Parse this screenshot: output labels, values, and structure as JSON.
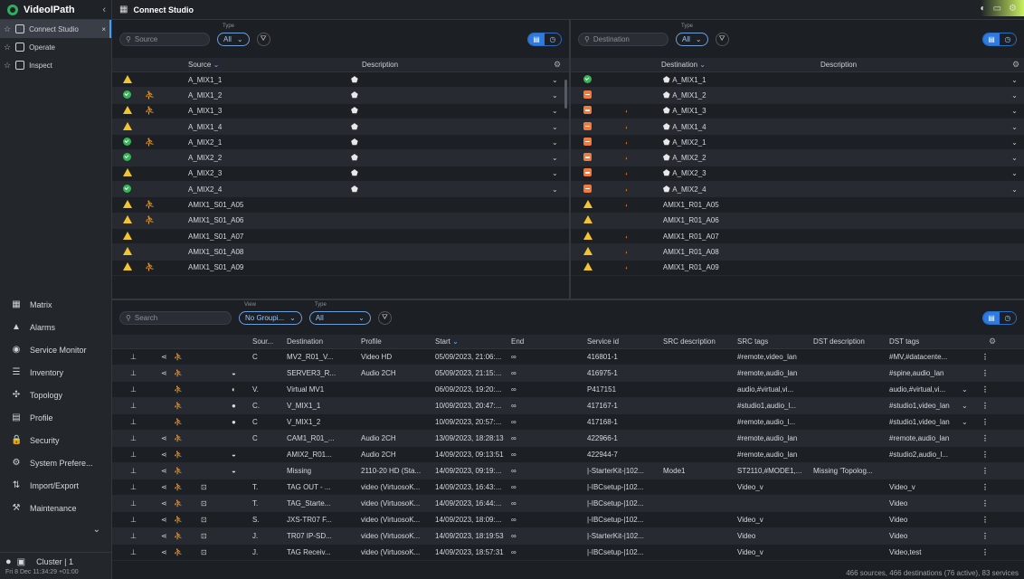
{
  "app": {
    "name": "VideoIPath",
    "collapse": "‹"
  },
  "sidebar": {
    "tabs": [
      {
        "label": "Connect Studio",
        "active": true,
        "close": "×"
      },
      {
        "label": "Operate",
        "active": false
      },
      {
        "label": "Inspect",
        "active": false
      }
    ],
    "menu": [
      {
        "label": "Matrix",
        "icon": "grid-icon",
        "glyph": "▦"
      },
      {
        "label": "Alarms",
        "icon": "alarm-icon",
        "glyph": "▲"
      },
      {
        "label": "Service Monitor",
        "icon": "eye-icon",
        "glyph": "◉"
      },
      {
        "label": "Inventory",
        "icon": "list-icon",
        "glyph": "☰"
      },
      {
        "label": "Topology",
        "icon": "topology-icon",
        "glyph": "✣"
      },
      {
        "label": "Profile",
        "icon": "profile-icon",
        "glyph": "▤"
      },
      {
        "label": "Security",
        "icon": "lock-icon",
        "glyph": "🔒"
      },
      {
        "label": "System Prefere...",
        "icon": "gear-icon",
        "glyph": "⚙"
      },
      {
        "label": "Import/Export",
        "icon": "import-export-icon",
        "glyph": "⇅"
      },
      {
        "label": "Maintenance",
        "icon": "maintenance-icon",
        "glyph": "⚒"
      }
    ],
    "more": "⌄",
    "footer": {
      "cluster": "Cluster | 1",
      "clock": "Fri 8 Dec  11:34:29 +01:00"
    }
  },
  "topbar": {
    "title": "Connect Studio"
  },
  "source_pane": {
    "search_placeholder": "Source",
    "type_label": "Type",
    "type_value": "All",
    "col_source": "Source",
    "col_description": "Description",
    "rows": [
      {
        "status": "warn",
        "person": false,
        "name": "A_MIX1_1",
        "hex": true,
        "chev": true
      },
      {
        "status": "ok",
        "person": true,
        "name": "A_MIX1_2",
        "hex": true,
        "chev": true
      },
      {
        "status": "warn",
        "person": true,
        "name": "A_MIX1_3",
        "hex": true,
        "chev": true
      },
      {
        "status": "warn",
        "person": false,
        "name": "A_MIX1_4",
        "hex": true,
        "chev": true
      },
      {
        "status": "ok",
        "person": true,
        "name": "A_MIX2_1",
        "hex": true,
        "chev": true
      },
      {
        "status": "ok",
        "person": false,
        "name": "A_MIX2_2",
        "hex": true,
        "chev": true
      },
      {
        "status": "warn",
        "person": false,
        "name": "A_MIX2_3",
        "hex": true,
        "chev": true
      },
      {
        "status": "ok",
        "person": false,
        "name": "A_MIX2_4",
        "hex": true,
        "chev": true
      },
      {
        "status": "warn",
        "person": true,
        "name": "AMIX1_S01_A05",
        "hex": false,
        "chev": false
      },
      {
        "status": "warn",
        "person": true,
        "name": "AMIX1_S01_A06",
        "hex": false,
        "chev": false
      },
      {
        "status": "warn",
        "person": false,
        "name": "AMIX1_S01_A07",
        "hex": false,
        "chev": false
      },
      {
        "status": "warn",
        "person": false,
        "name": "AMIX1_S01_A08",
        "hex": false,
        "chev": false
      },
      {
        "status": "warn",
        "person": true,
        "name": "AMIX1_S01_A09",
        "hex": false,
        "chev": false
      }
    ]
  },
  "dest_pane": {
    "search_placeholder": "Destination",
    "type_label": "Type",
    "type_value": "All",
    "col_destination": "Destination",
    "col_description": "Description",
    "rows": [
      {
        "status": "ok",
        "person": false,
        "name": "A_MIX1_1",
        "hex": true,
        "chev": true
      },
      {
        "status": "err",
        "person": false,
        "name": "A_MIX1_2",
        "hex": true,
        "chev": true
      },
      {
        "status": "err",
        "person": true,
        "name": "A_MIX1_3",
        "hex": true,
        "chev": true
      },
      {
        "status": "err",
        "person": true,
        "name": "A_MIX1_4",
        "hex": true,
        "chev": true
      },
      {
        "status": "err",
        "person": true,
        "name": "A_MIX2_1",
        "hex": true,
        "chev": true
      },
      {
        "status": "err",
        "person": true,
        "name": "A_MIX2_2",
        "hex": true,
        "chev": true
      },
      {
        "status": "err",
        "person": true,
        "name": "A_MIX2_3",
        "hex": true,
        "chev": true
      },
      {
        "status": "err",
        "person": true,
        "name": "A_MIX2_4",
        "hex": true,
        "chev": true
      },
      {
        "status": "warn",
        "person": true,
        "name": "AMIX1_R01_A05",
        "hex": false,
        "chev": false
      },
      {
        "status": "warn",
        "person": false,
        "name": "AMIX1_R01_A06",
        "hex": false,
        "chev": false
      },
      {
        "status": "warn",
        "person": true,
        "name": "AMIX1_R01_A07",
        "hex": false,
        "chev": false
      },
      {
        "status": "warn",
        "person": true,
        "name": "AMIX1_R01_A08",
        "hex": false,
        "chev": false
      },
      {
        "status": "warn",
        "person": true,
        "name": "AMIX1_R01_A09",
        "hex": false,
        "chev": false
      }
    ]
  },
  "services": {
    "search_placeholder": "Search",
    "view_label": "View",
    "view_value": "No Groupi...",
    "type_label": "Type",
    "type_value": "All",
    "columns": {
      "source": "Sour...",
      "destination": "Destination",
      "profile": "Profile",
      "start": "Start",
      "end": "End",
      "service_id": "Service id",
      "src_desc": "SRC description",
      "src_tags": "SRC tags",
      "dst_desc": "DST description",
      "dst_tags": "DST tags"
    },
    "rows": [
      {
        "status": "err",
        "share": true,
        "person": true,
        "lock": false,
        "diamond": "",
        "type": "C",
        "destination": "MV2_R01_V...",
        "profile": "Video HD",
        "start": "05/09/2023, 21:06:...",
        "end": "∞",
        "service_id": "416801-1",
        "src_desc": "",
        "src_tags": "#remote,video_lan",
        "dst_desc": "",
        "dst_tags": "#MV,#datacente...",
        "chev": false
      },
      {
        "status": "err",
        "share": true,
        "person": true,
        "lock": false,
        "diamond": "◒",
        "type": "",
        "destination": "SERVER3_R...",
        "profile": "Audio 2CH",
        "start": "05/09/2023, 21:15:...",
        "end": "∞",
        "service_id": "416975-1",
        "src_desc": "",
        "src_tags": "#remote,audio_lan",
        "dst_desc": "",
        "dst_tags": "#spine,audio_lan",
        "chev": false
      },
      {
        "status": "ok",
        "share": false,
        "person": true,
        "lock": false,
        "diamond": "◐",
        "type": "V.",
        "destination": "Virtual MV1",
        "profile": "",
        "start": "06/09/2023, 19:20:...",
        "end": "∞",
        "service_id": "P417151",
        "src_desc": "",
        "src_tags": "audio,#virtual,vi...",
        "dst_desc": "",
        "dst_tags": "audio,#virtual,vi...",
        "chev": true
      },
      {
        "status": "err",
        "share": false,
        "person": true,
        "lock": false,
        "diamond": "●",
        "type": "C.",
        "destination": "V_MIX1_1",
        "profile": "",
        "start": "10/09/2023, 20:47:...",
        "end": "∞",
        "service_id": "417167-1",
        "src_desc": "",
        "src_tags": "#studio1,audio_l...",
        "dst_desc": "",
        "dst_tags": "#studio1,video_lan",
        "chev": true
      },
      {
        "status": "err",
        "share": false,
        "person": true,
        "lock": false,
        "diamond": "●",
        "type": "C",
        "destination": "V_MIX1_2",
        "profile": "",
        "start": "10/09/2023, 20:57:...",
        "end": "∞",
        "service_id": "417168-1",
        "src_desc": "",
        "src_tags": "#remote,audio_l...",
        "dst_desc": "",
        "dst_tags": "#studio1,video_lan",
        "chev": true
      },
      {
        "status": "err",
        "share": true,
        "person": true,
        "lock": false,
        "diamond": "",
        "type": "C",
        "destination": "CAM1_R01_...",
        "profile": "Audio 2CH",
        "start": "13/09/2023, 18:28:13",
        "end": "∞",
        "service_id": "422966-1",
        "src_desc": "",
        "src_tags": "#remote,audio_lan",
        "dst_desc": "",
        "dst_tags": "#remote,audio_lan",
        "chev": false
      },
      {
        "status": "err",
        "share": true,
        "person": true,
        "lock": false,
        "diamond": "◒",
        "type": "",
        "destination": "AMIX2_R01...",
        "profile": "Audio 2CH",
        "start": "14/09/2023, 09:13:51",
        "end": "∞",
        "service_id": "422944-7",
        "src_desc": "",
        "src_tags": "#remote,audio_lan",
        "dst_desc": "",
        "dst_tags": "#studio2,audio_l...",
        "chev": false
      },
      {
        "status": "err",
        "share": true,
        "person": true,
        "lock": false,
        "diamond": "◒",
        "type": "",
        "destination": "Missing",
        "profile": "2110-20 HD (Sta...",
        "start": "14/09/2023, 09:19:...",
        "end": "∞",
        "service_id": "|-StarterKit-|102...",
        "src_desc": "Mode1",
        "src_tags": "ST2110,#MODE1,...",
        "dst_desc": "Missing 'Topolog...",
        "dst_tags": "",
        "chev": false
      },
      {
        "status": "ok",
        "share": true,
        "person": true,
        "lock": true,
        "diamond": "",
        "type": "T.",
        "destination": "TAG OUT - ...",
        "profile": "video (VirtuosoK...",
        "start": "14/09/2023, 16:43:...",
        "end": "∞",
        "service_id": "|-IBCsetup-|102...",
        "src_desc": "",
        "src_tags": "Video_v",
        "dst_desc": "",
        "dst_tags": "Video_v",
        "chev": false
      },
      {
        "status": "err",
        "share": true,
        "person": true,
        "lock": true,
        "diamond": "",
        "type": "T.",
        "destination": "TAG_Starte...",
        "profile": "video (VirtuosoK...",
        "start": "14/09/2023, 16:44:...",
        "end": "∞",
        "service_id": "|-IBCsetup-|102...",
        "src_desc": "",
        "src_tags": "",
        "dst_desc": "",
        "dst_tags": "Video",
        "chev": false
      },
      {
        "status": "ok",
        "share": true,
        "person": true,
        "lock": true,
        "diamond": "",
        "type": "S.",
        "destination": "JXS-TR07 F...",
        "profile": "video (VirtuosoK...",
        "start": "14/09/2023, 18:09:...",
        "end": "∞",
        "service_id": "|-IBCsetup-|102...",
        "src_desc": "",
        "src_tags": "Video_v",
        "dst_desc": "",
        "dst_tags": "Video",
        "chev": false
      },
      {
        "status": "ok",
        "share": true,
        "person": true,
        "lock": true,
        "diamond": "",
        "type": "J.",
        "destination": "TR07 IP-SD...",
        "profile": "video (VirtuosoK...",
        "start": "14/09/2023, 18:19:53",
        "end": "∞",
        "service_id": "|-StarterKit-|102...",
        "src_desc": "",
        "src_tags": "Video",
        "dst_desc": "",
        "dst_tags": "Video",
        "chev": false
      },
      {
        "status": "ok",
        "share": true,
        "person": true,
        "lock": true,
        "diamond": "",
        "type": "J.",
        "destination": "TAG Receiv...",
        "profile": "video (VirtuosoK...",
        "start": "14/09/2023, 18:57:31",
        "end": "∞",
        "service_id": "|-IBCsetup-|102...",
        "src_desc": "",
        "src_tags": "Video_v",
        "dst_desc": "",
        "dst_tags": "Video,test",
        "chev": false
      }
    ],
    "status_text": "466 sources, 466 destinations (76 active), 83 services"
  },
  "colors": {
    "accent": "#2d7be0",
    "warn": "#f2c431",
    "ok": "#35b556",
    "err": "#f27a3d",
    "bg": "#1c1f24"
  }
}
